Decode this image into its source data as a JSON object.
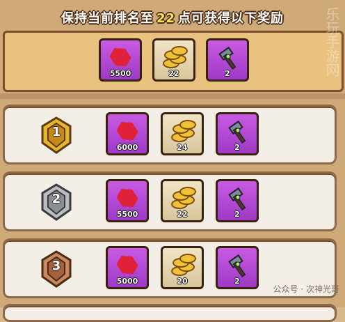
{
  "header": {
    "prefix": "保持当前排名至",
    "number": "22",
    "suffix": "点可获得以下奖励"
  },
  "top_rewards": {
    "ruby_qty": "5500",
    "coin_qty": "22",
    "hammer_qty": "2"
  },
  "ranks": [
    {
      "rank": "1",
      "ruby_qty": "6000",
      "coin_qty": "24",
      "hammer_qty": "2",
      "medal_color": "#e7b52b"
    },
    {
      "rank": "2",
      "ruby_qty": "5500",
      "coin_qty": "22",
      "hammer_qty": "2",
      "medal_color": "#b9bcc2"
    },
    {
      "rank": "3",
      "ruby_qty": "5000",
      "coin_qty": "20",
      "hammer_qty": "2",
      "medal_color": "#c98860"
    }
  ],
  "watermark": {
    "source": "公众号 · 次神光哥",
    "side_text": "乐玩手游网"
  },
  "colors": {
    "panel_bg": "#e9c27f",
    "row_bg": "#f4efe6",
    "item_purple": "#b84ad8",
    "item_beige": "#e6d6ad"
  }
}
